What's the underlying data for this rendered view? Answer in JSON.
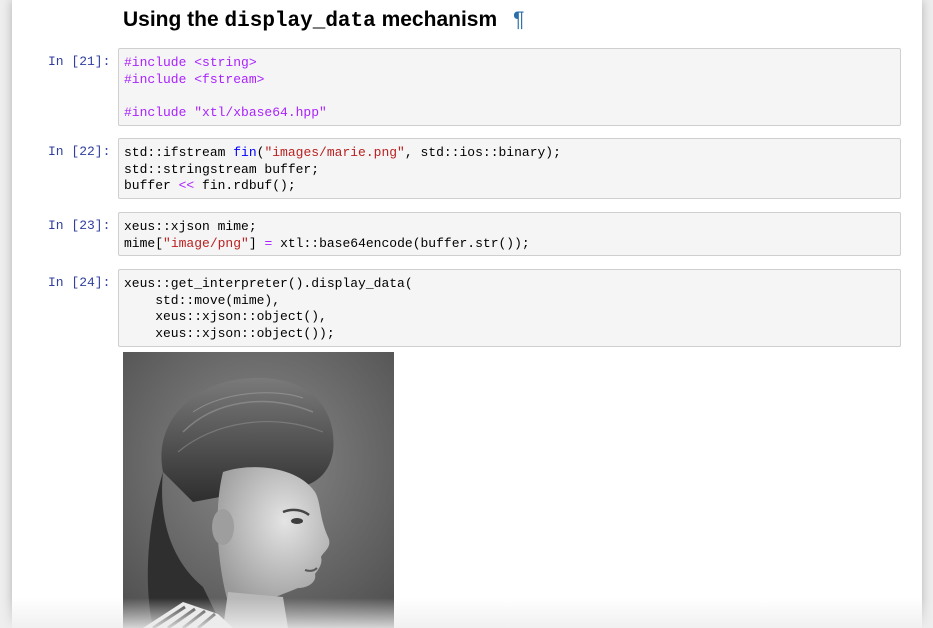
{
  "section": {
    "title_prefix": "Using the ",
    "title_code": "display_data",
    "title_suffix": " mechanism",
    "anchor_symbol": "¶"
  },
  "cells": [
    {
      "prompt": "In [21]:",
      "lines": [
        [
          {
            "t": "#include <string>",
            "c": "kw"
          }
        ],
        [
          {
            "t": "#include <fstream>",
            "c": "kw"
          }
        ],
        [],
        [
          {
            "t": "#include \"xtl/xbase64.hpp\"",
            "c": "kw"
          }
        ]
      ]
    },
    {
      "prompt": "In [22]:",
      "lines": [
        [
          {
            "t": "std::ifstream "
          },
          {
            "t": "fin",
            "c": "fn"
          },
          {
            "t": "("
          },
          {
            "t": "\"images/marie.png\"",
            "c": "str"
          },
          {
            "t": ", std::ios::binary);"
          }
        ],
        [
          {
            "t": "std::stringstream buffer;"
          }
        ],
        [
          {
            "t": "buffer "
          },
          {
            "t": "<<",
            "c": "op"
          },
          {
            "t": " fin.rdbuf();"
          }
        ]
      ]
    },
    {
      "prompt": "In [23]:",
      "lines": [
        [
          {
            "t": "xeus::xjson mime;"
          }
        ],
        [
          {
            "t": "mime["
          },
          {
            "t": "\"image/png\"",
            "c": "str"
          },
          {
            "t": "] "
          },
          {
            "t": "=",
            "c": "op"
          },
          {
            "t": " xtl::base64encode(buffer.str());"
          }
        ]
      ]
    },
    {
      "prompt": "In [24]:",
      "lines": [
        [
          {
            "t": "xeus::get_interpreter().display_data("
          }
        ],
        [
          {
            "t": "    std::move(mime),"
          }
        ],
        [
          {
            "t": "    xeus::xjson::object(),"
          }
        ],
        [
          {
            "t": "    xeus::xjson::object());"
          }
        ]
      ]
    }
  ],
  "output": {
    "image": "portrait-photo",
    "colors": {
      "background": "#6e6e6e",
      "hair": "#3a3a3a",
      "skin": "#cfcfcf"
    }
  }
}
